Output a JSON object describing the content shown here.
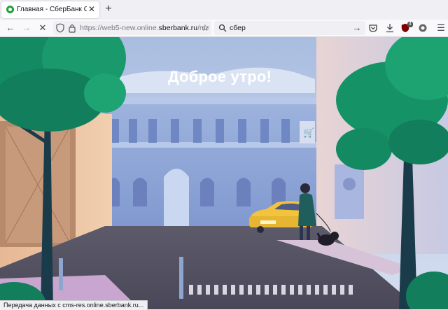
{
  "tab": {
    "title": "Главная - СберБанк Онлайн",
    "close_icon": "close-icon"
  },
  "toolbar": {
    "url_prefix": "https://web5-new.online.",
    "url_domain": "sberbank.ru",
    "url_suffix": "/main",
    "search_query": "сбер",
    "extension_badge": "4"
  },
  "page": {
    "greeting": "Доброе утро!"
  },
  "status": {
    "text": "Передача данных с cms-res.online.sberbank.ru..."
  },
  "colors": {
    "sber_green": "#21a038",
    "tree_green": "#1b9a6a",
    "sky": "#c9d6ee"
  }
}
